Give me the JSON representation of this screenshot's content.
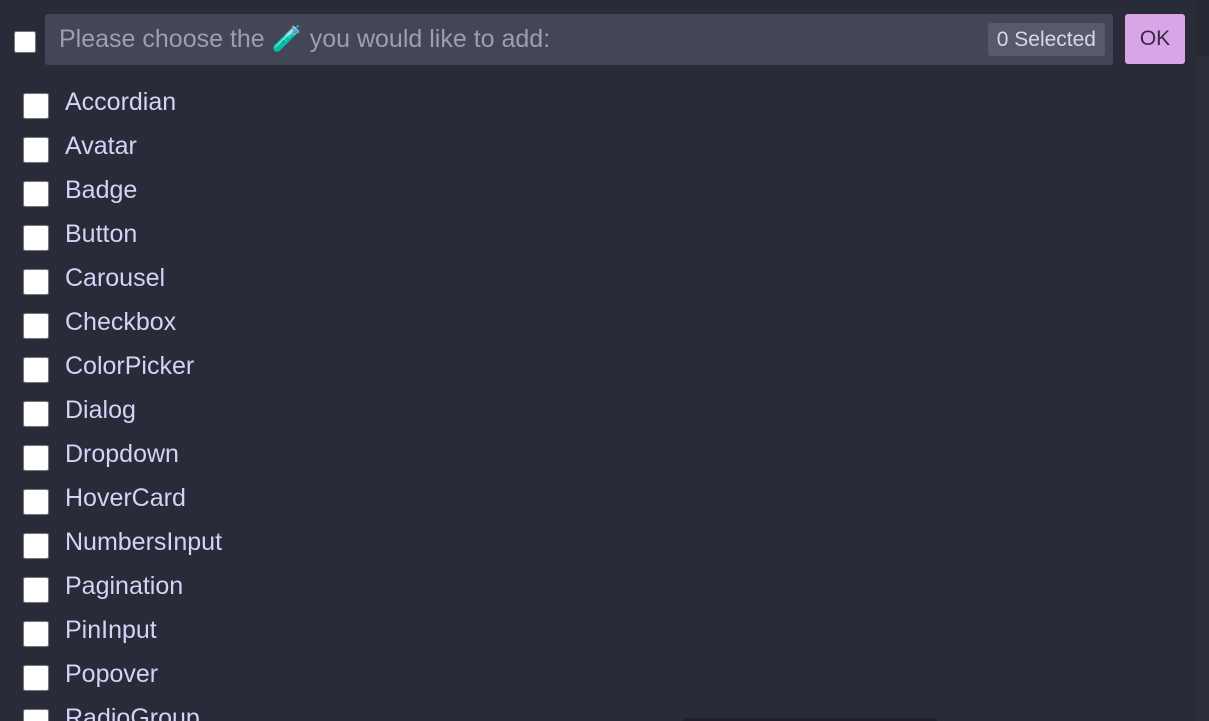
{
  "header": {
    "search_placeholder": "Please choose the 🧪 you would like to add:",
    "search_value": "",
    "selected_count": "0 Selected",
    "ok_label": "OK",
    "master_checked": false
  },
  "options": [
    {
      "label": "Accordian",
      "checked": false
    },
    {
      "label": "Avatar",
      "checked": false
    },
    {
      "label": "Badge",
      "checked": false
    },
    {
      "label": "Button",
      "checked": false
    },
    {
      "label": "Carousel",
      "checked": false
    },
    {
      "label": "Checkbox",
      "checked": false
    },
    {
      "label": "ColorPicker",
      "checked": false
    },
    {
      "label": "Dialog",
      "checked": false
    },
    {
      "label": "Dropdown",
      "checked": false
    },
    {
      "label": "HoverCard",
      "checked": false
    },
    {
      "label": "NumbersInput",
      "checked": false
    },
    {
      "label": "Pagination",
      "checked": false
    },
    {
      "label": "PinInput",
      "checked": false
    },
    {
      "label": "Popover",
      "checked": false
    },
    {
      "label": "RadioGroup",
      "checked": false
    }
  ],
  "colors": {
    "background": "#292b38",
    "search_bg": "#434657",
    "accent_button": "#d8a6e6",
    "label_text": "#d0d4f6"
  }
}
